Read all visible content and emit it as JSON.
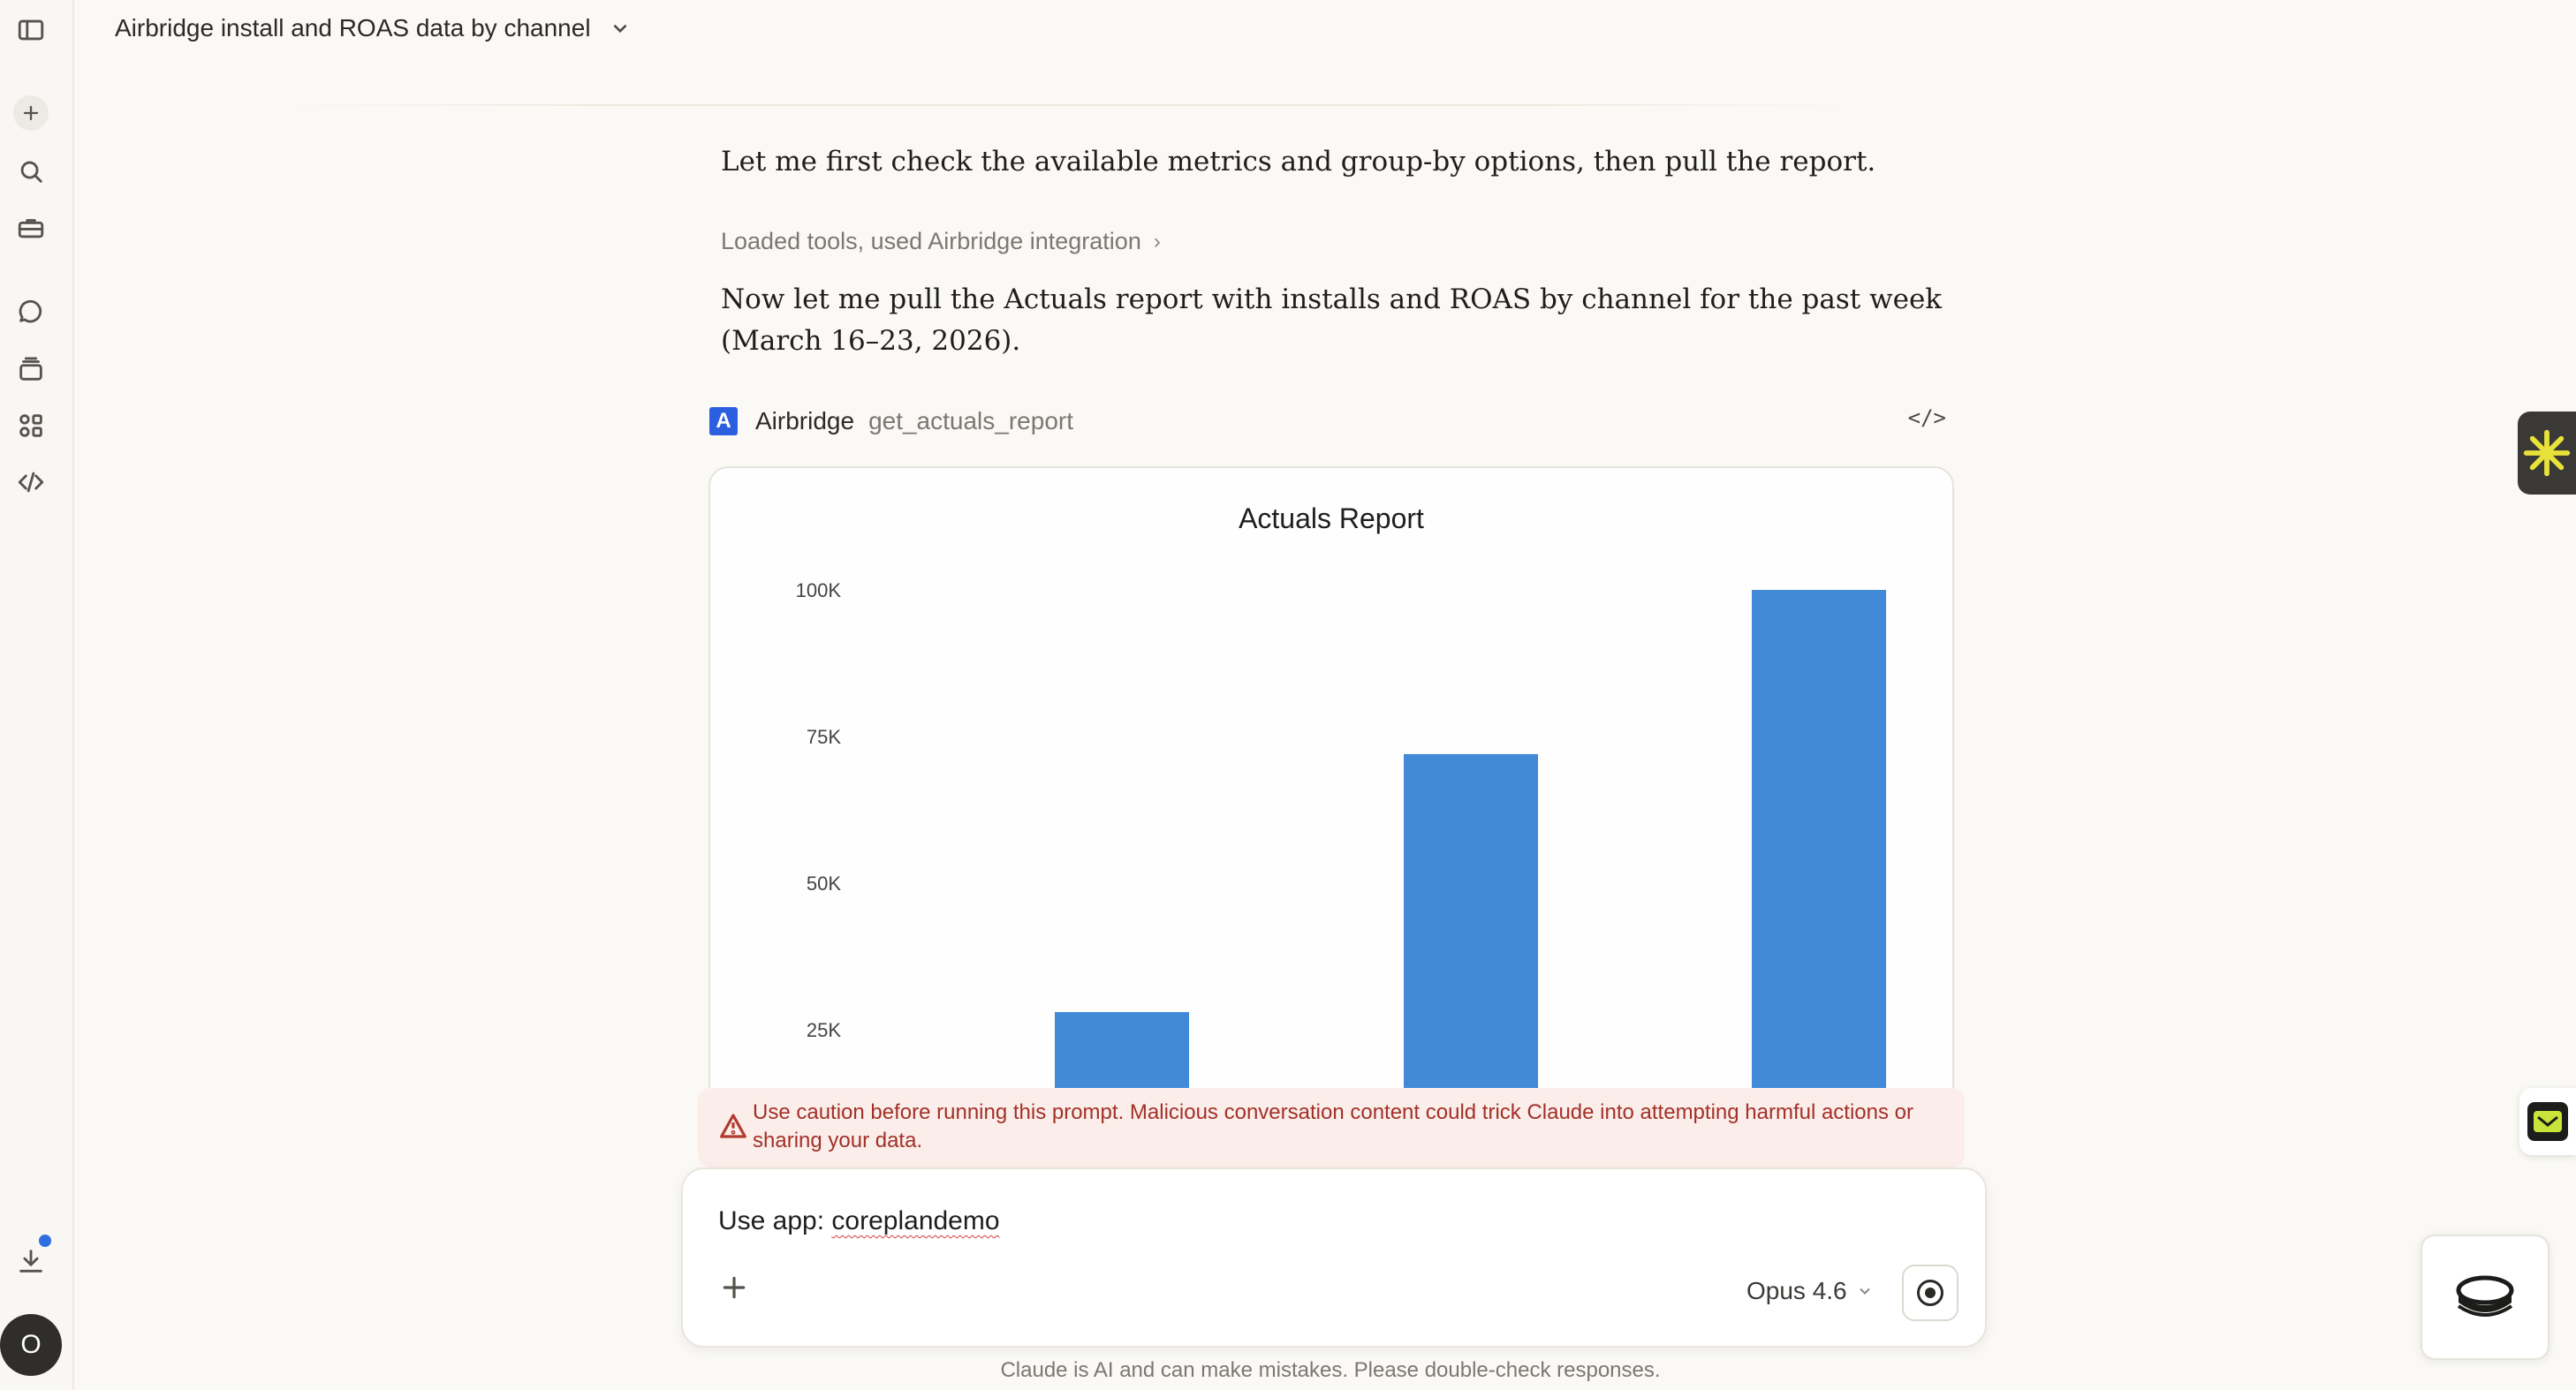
{
  "header": {
    "title": "Airbridge install and ROAS data by channel"
  },
  "sidebar": {
    "items": [
      "sidebar-toggle-icon",
      "new-chat-icon",
      "search-icon",
      "toolbox-icon",
      "chats-icon",
      "projects-icon",
      "artifacts-icon",
      "code-icon"
    ],
    "avatar_initial": "O"
  },
  "messages": {
    "first": "Let me first check the available metrics and group-by options, then pull the report.",
    "tools_summary": "Loaded tools, used Airbridge integration",
    "tools_chevron": "›",
    "second_line1": "Now let me pull the Actuals report with installs and ROAS by channel for the past week",
    "second_line2": "(March 16–23, 2026)."
  },
  "tool_call": {
    "badge": "A",
    "name": "Airbridge",
    "function": "get_actuals_report",
    "code_toggle": "</>"
  },
  "chart_data": {
    "type": "bar",
    "title": "Actuals Report",
    "yticks": [
      "100K",
      "75K",
      "50K",
      "25K"
    ],
    "ytick_values": [
      100000,
      75000,
      50000,
      25000
    ],
    "categories": [
      "",
      "",
      ""
    ],
    "values": [
      28000,
      72000,
      100000
    ],
    "ylim": [
      0,
      100000
    ],
    "bar_color": "#4289d8",
    "grid": false
  },
  "caution": {
    "text": "Use caution before running this prompt. Malicious conversation content could trick Claude into attempting harmful actions or sharing your data."
  },
  "composer": {
    "prefix": "Use app: ",
    "app_name": "coreplandemo",
    "model": "Opus 4.6"
  },
  "footer": {
    "disclaimer": "Claude is AI and can make mistakes. Please double-check responses."
  },
  "colors": {
    "accent": "#2c5fdf",
    "bar": "#4289d8",
    "caution_bg": "#fbeeea",
    "caution_text": "#a33028"
  }
}
